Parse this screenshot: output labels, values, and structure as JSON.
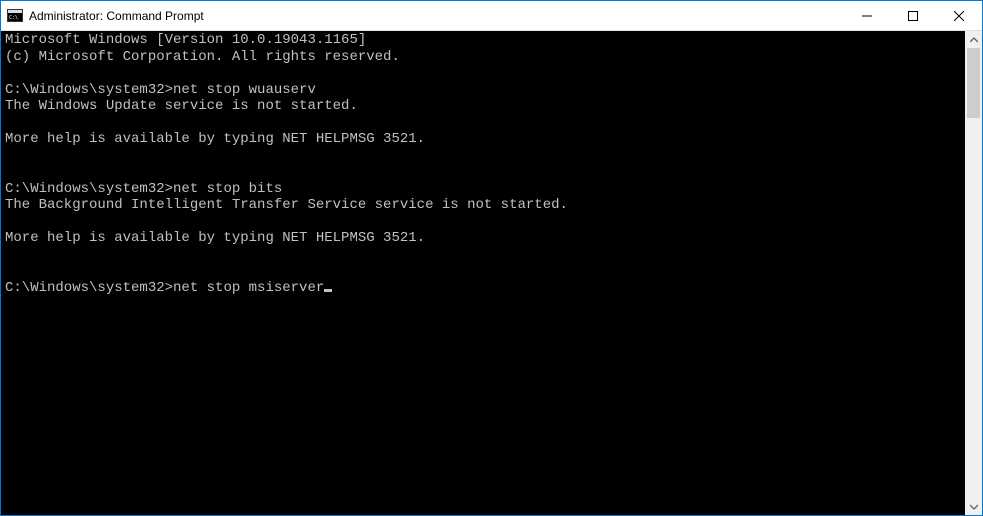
{
  "window": {
    "title": "Administrator: Command Prompt"
  },
  "terminal": {
    "lines": {
      "l0": "Microsoft Windows [Version 10.0.19043.1165]",
      "l1": "(c) Microsoft Corporation. All rights reserved.",
      "l2_prompt": "C:\\Windows\\system32>",
      "l2_cmd": "net stop wuauserv",
      "l3": "The Windows Update service is not started.",
      "l4": "More help is available by typing NET HELPMSG 3521.",
      "l5_prompt": "C:\\Windows\\system32>",
      "l5_cmd": "net stop bits",
      "l6": "The Background Intelligent Transfer Service service is not started.",
      "l7": "More help is available by typing NET HELPMSG 3521.",
      "l8_prompt": "C:\\Windows\\system32>",
      "l8_cmd": "net stop msiserver"
    }
  }
}
